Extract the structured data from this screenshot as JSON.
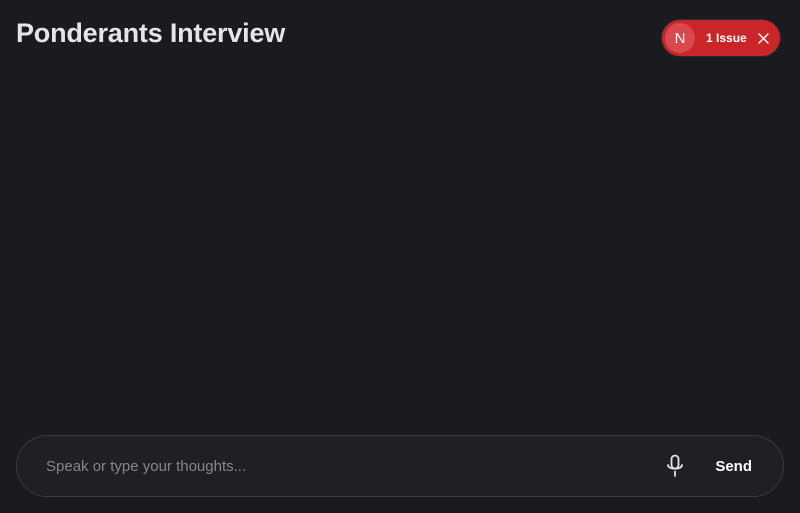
{
  "header": {
    "title": "Ponderants Interview"
  },
  "issue_badge": {
    "avatar_letter": "N",
    "label": "1 Issue",
    "close_icon": "close-icon",
    "color": "#c9262a"
  },
  "composer": {
    "placeholder": "Speak or type your thoughts...",
    "value": "",
    "mic_icon": "microphone-icon",
    "send_label": "Send"
  },
  "colors": {
    "background": "#1a1b1e",
    "composer_bg": "#1f2023",
    "composer_border": "#3a3c40",
    "text": "#e4e5e7"
  }
}
